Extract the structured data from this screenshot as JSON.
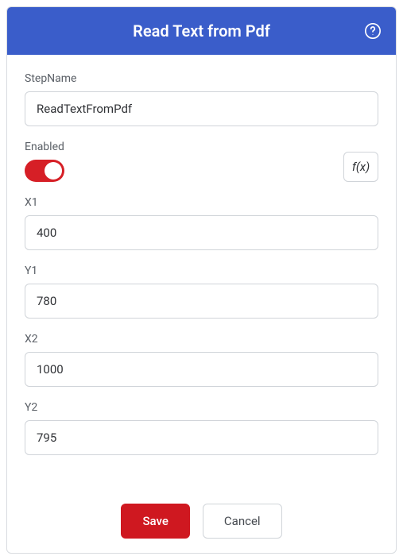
{
  "header": {
    "title": "Read Text from Pdf"
  },
  "form": {
    "stepName": {
      "label": "StepName",
      "value": "ReadTextFromPdf"
    },
    "enabled": {
      "label": "Enabled",
      "value": true
    },
    "fxLabel": "f(x)",
    "x1": {
      "label": "X1",
      "value": "400"
    },
    "y1": {
      "label": "Y1",
      "value": "780"
    },
    "x2": {
      "label": "X2",
      "value": "1000"
    },
    "y2": {
      "label": "Y2",
      "value": "795"
    }
  },
  "buttons": {
    "save": "Save",
    "cancel": "Cancel"
  }
}
